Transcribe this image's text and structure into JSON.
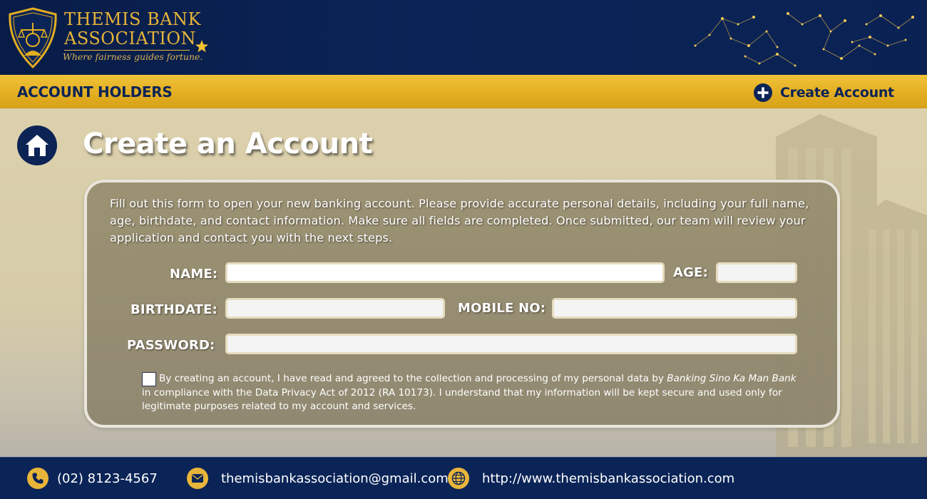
{
  "brand": {
    "name_line1": "THEMIS BANK",
    "name_line2": "ASSOCIATION",
    "tagline": "Where fairness guides fortune.",
    "colors": {
      "navy": "#0b2457",
      "gold": "#e3ad20",
      "white": "#ffffff"
    }
  },
  "subheader": {
    "title": "ACCOUNT HOLDERS",
    "create_account_label": "Create Account",
    "create_account_icon": "plus-circle-icon"
  },
  "main": {
    "home_icon": "home-icon",
    "page_title": "Create an Account",
    "intro": "Fill out this form to open your new banking account. Please provide accurate personal details, including your full name, age, birthdate, and contact information. Make sure all fields are completed. Once submitted, our team will review your application and contact you with the next steps."
  },
  "form": {
    "name_label": "NAME:",
    "name_value": "",
    "age_label": "AGE:",
    "age_value": "",
    "birthdate_label": "BIRTHDATE:",
    "birthdate_value": "",
    "mobile_label": "MOBILE NO:",
    "mobile_value": "",
    "password_label": "PASSWORD:",
    "password_value": "",
    "consent_checked": false,
    "consent_prefix": "By creating an account, I have read and agreed to the collection and processing of my personal data by ",
    "consent_bank": "Banking Sino Ka Man Bank",
    "consent_suffix": " in compliance with the Data Privacy Act of 2012 (RA 10173). I understand that my information will be kept secure and used only for legitimate purposes related to my account and services."
  },
  "footer": {
    "phone": "(02) 8123-4567",
    "phone_icon": "phone-icon",
    "email": "themisbankassociation@gmail.com",
    "email_icon": "mail-icon",
    "website": "http://www.themisbankassociation.com",
    "website_icon": "globe-icon"
  }
}
